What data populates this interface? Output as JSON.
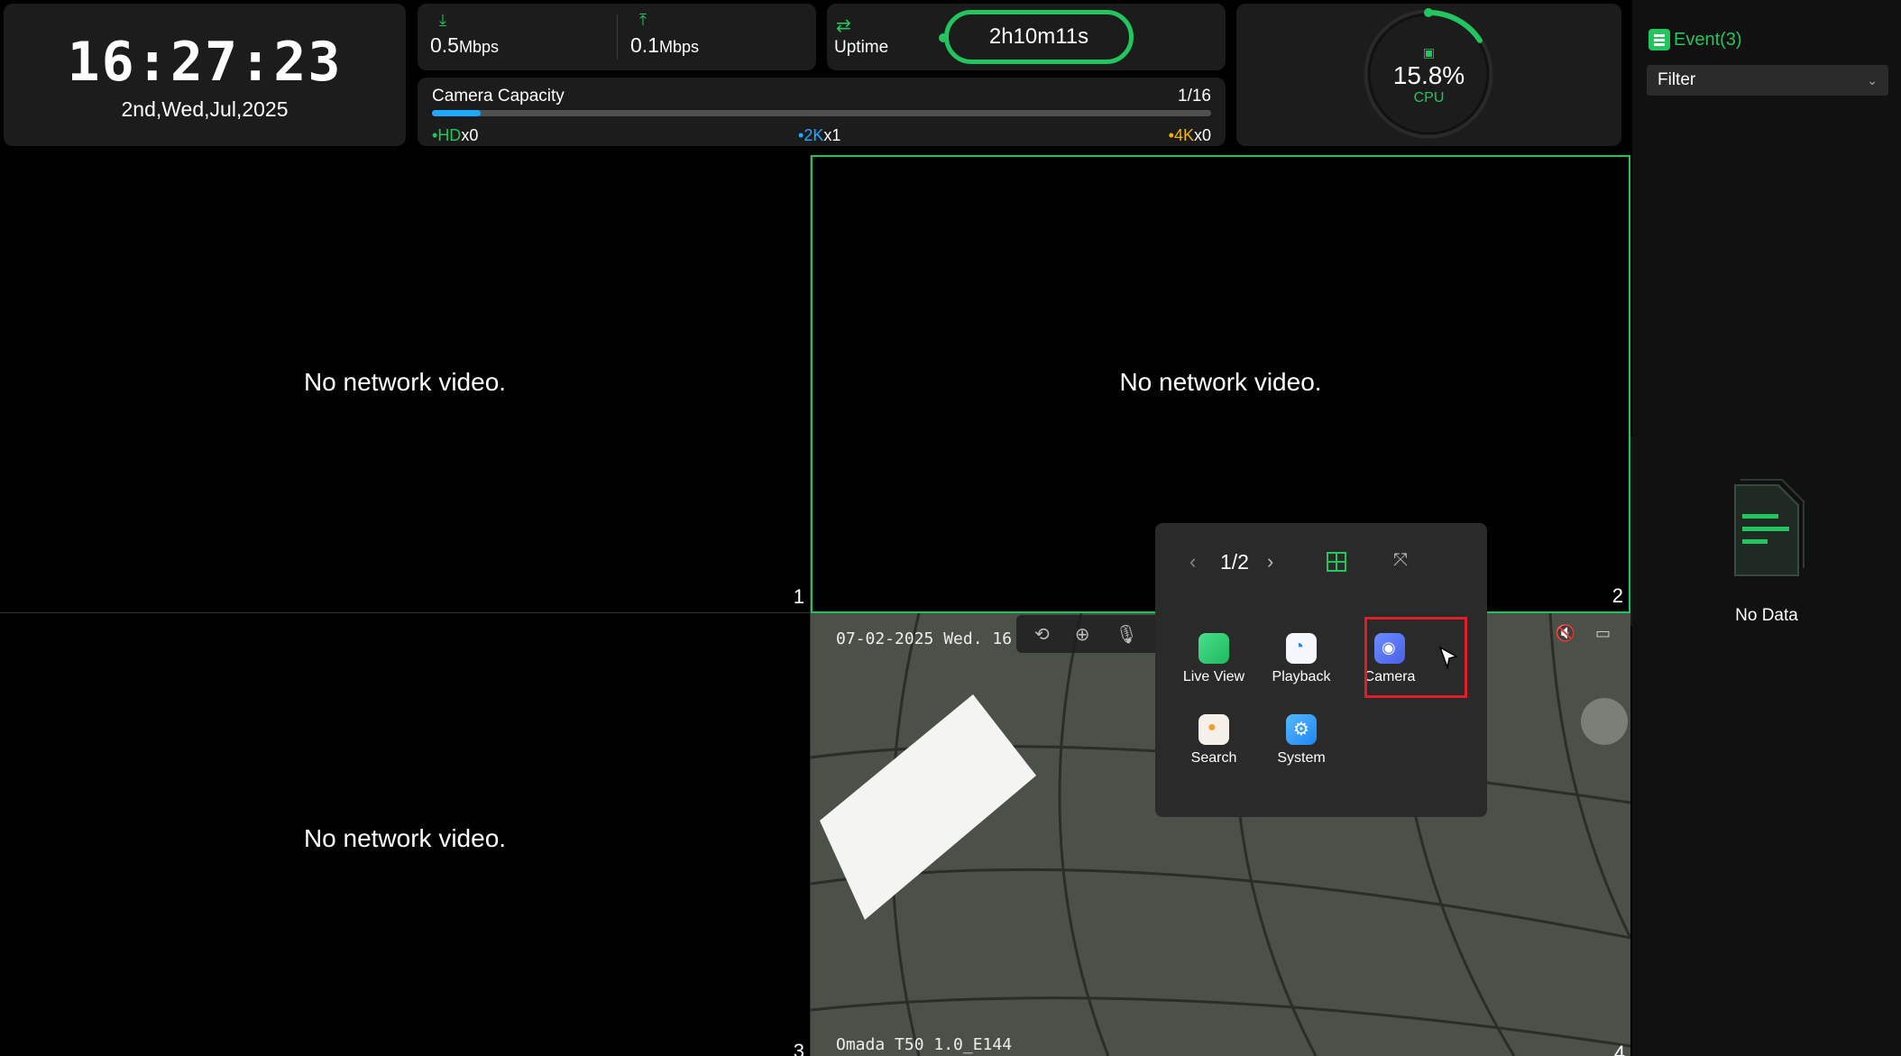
{
  "clock": {
    "time": "16:27:23",
    "date": "2nd,Wed,Jul,2025"
  },
  "network": {
    "download": {
      "value": "0.5",
      "unit": "Mbps"
    },
    "upload": {
      "value": "0.1",
      "unit": "Mbps"
    }
  },
  "uptime": {
    "label": "Uptime",
    "value": "2h10m11s"
  },
  "capacity": {
    "title": "Camera Capacity",
    "count": "1/16",
    "fill_fraction": 0.0625,
    "hd": {
      "label": "HD",
      "count": "x0",
      "color": "#22c55e"
    },
    "k2": {
      "label": "2K",
      "count": "x1",
      "color": "#1fa8ff"
    },
    "k4": {
      "label": "4K",
      "count": "x0",
      "color": "#f5b400"
    }
  },
  "cpu": {
    "value": "15.8%",
    "label": "CPU",
    "fraction": 0.158
  },
  "events": {
    "title": "Event(3)",
    "filter": "Filter",
    "empty": "No Data"
  },
  "cells": [
    {
      "message": "No network video.",
      "number": "1"
    },
    {
      "message": "No network video.",
      "number": "2"
    },
    {
      "message": "No network video.",
      "number": "3"
    },
    {
      "number": "4",
      "osd_date": "07-02-2025 Wed. 16",
      "osd_model": "Omada T50 1.0_E144"
    }
  ],
  "popup": {
    "page": "1/2",
    "apps": [
      {
        "label": "Live View",
        "icon": "live-view-icon"
      },
      {
        "label": "Playback",
        "icon": "playback-icon"
      },
      {
        "label": "Camera",
        "icon": "camera-icon"
      },
      {
        "label": "Search",
        "icon": "search-icon"
      },
      {
        "label": "System",
        "icon": "system-icon"
      }
    ]
  },
  "colors": {
    "accent": "#22c55e",
    "highlight": "#e11d2a"
  }
}
